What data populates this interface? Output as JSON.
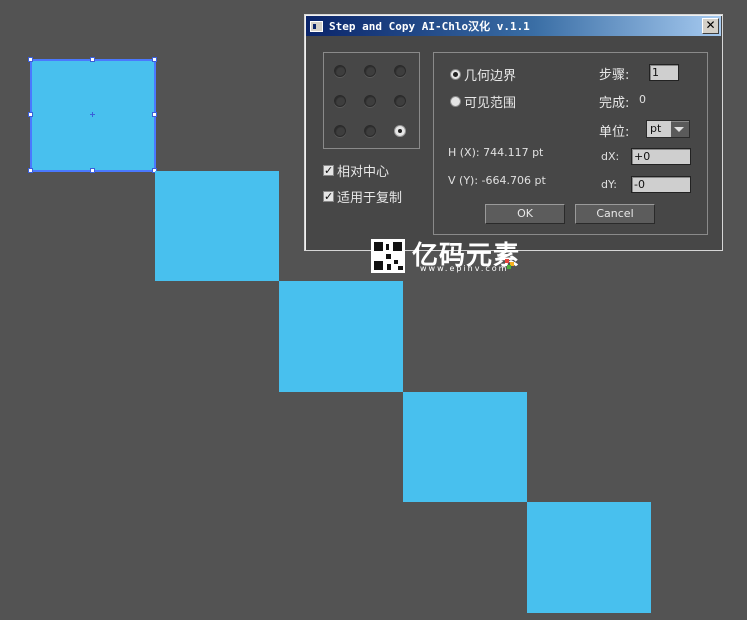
{
  "dialog": {
    "title": "Step and Copy AI-Chlo汉化 v.1.1",
    "close_label": "✕",
    "anchor_grid": {
      "selected_index": 8,
      "count": 9
    },
    "checkboxes": [
      {
        "label": "相对中心",
        "checked": true
      },
      {
        "label": "适用于复制",
        "checked": true
      }
    ],
    "radios": [
      {
        "label": "几何边界",
        "selected": true
      },
      {
        "label": "可见范围",
        "selected": false
      }
    ],
    "h_value": "H (X): 744.117 pt",
    "v_value": "V (Y): -664.706 pt",
    "steps_label": "步骤:",
    "steps_value": "1",
    "done_label": "完成:",
    "done_value": "0",
    "unit_label": "单位:",
    "unit_value": "pt",
    "dx_label": "dX:",
    "dx_value": "+0",
    "dy_label": "dY:",
    "dy_value": "-0",
    "ok_label": "OK",
    "cancel_label": "Cancel"
  },
  "watermark": {
    "title": "亿码元素",
    "url": "www.epinv.com"
  },
  "colors": {
    "canvas": "#535353",
    "square": "#48c0ee",
    "selection": "#4a78ff"
  }
}
